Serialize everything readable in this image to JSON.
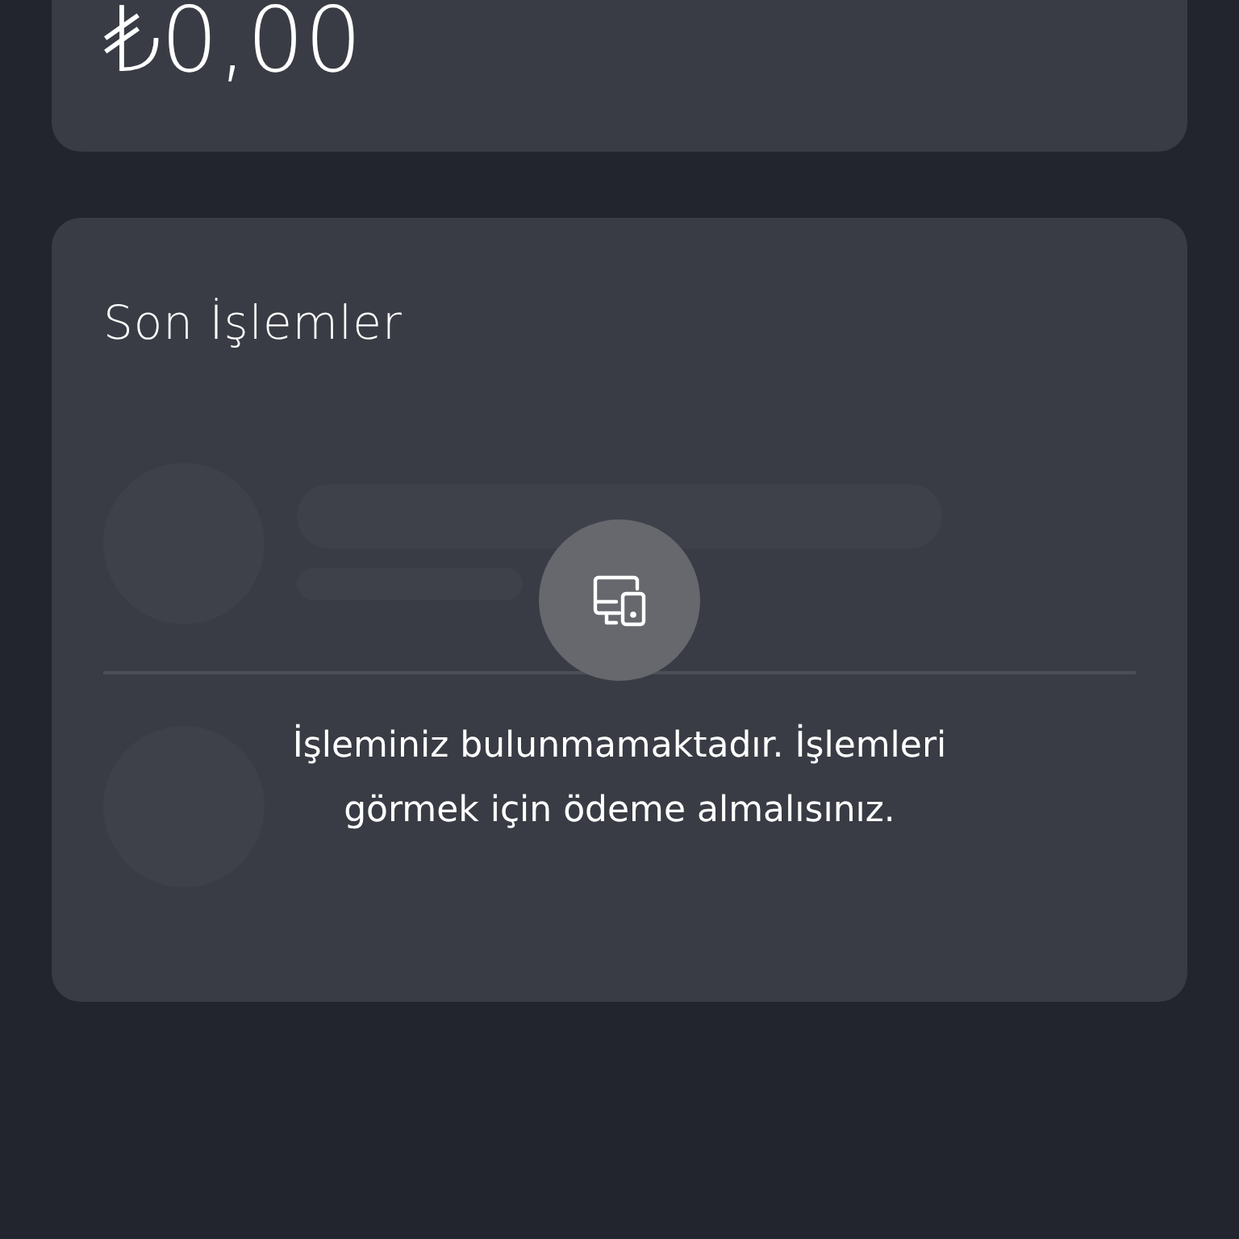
{
  "balance_card": {
    "amount": "₺0,00"
  },
  "transactions_card": {
    "title": "Son İşlemler",
    "empty_message": "İşleminiz bulunmamaktadır. İşlemleri görmek için ödeme almalısınız."
  }
}
